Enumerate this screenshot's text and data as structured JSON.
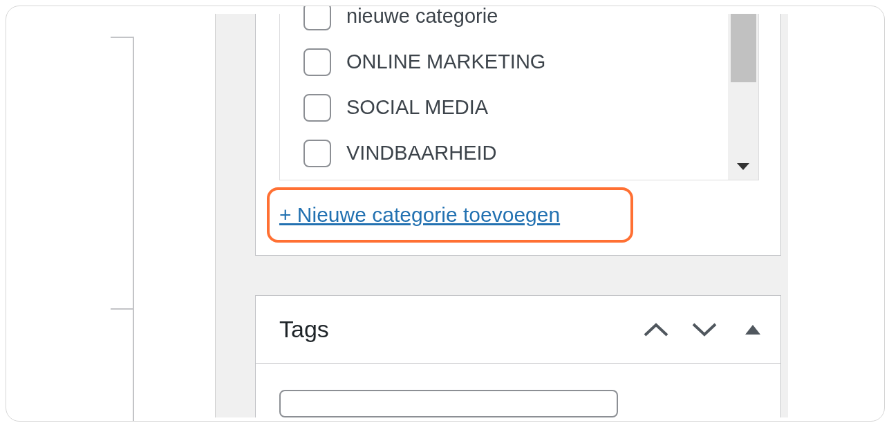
{
  "categories": {
    "items": [
      {
        "label": "nieuwe categorie",
        "checked": false
      },
      {
        "label": "ONLINE MARKETING",
        "checked": false
      },
      {
        "label": "SOCIAL MEDIA",
        "checked": false
      },
      {
        "label": "VINDBAARHEID",
        "checked": false
      }
    ],
    "add_link": "+ Nieuwe categorie toevoegen"
  },
  "tags": {
    "title": "Tags"
  }
}
